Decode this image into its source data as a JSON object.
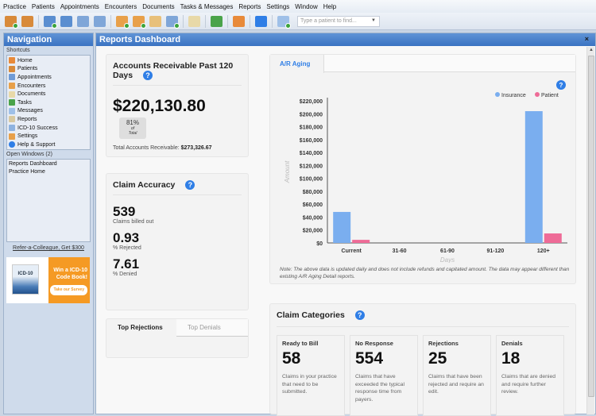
{
  "menu": [
    "Practice",
    "Patients",
    "Appointments",
    "Encounters",
    "Documents",
    "Tasks & Messages",
    "Reports",
    "Settings",
    "Window",
    "Help"
  ],
  "toolbar": {
    "icons": [
      {
        "name": "add-patient-icon",
        "color": "#d88a3a",
        "badge": true
      },
      {
        "name": "find-patient-icon",
        "color": "#d88a3a",
        "badge": false
      },
      {
        "name": "add-appointment-icon",
        "color": "#5a8ed0",
        "badge": true
      },
      {
        "name": "appointment-list-icon",
        "color": "#5a8ed0",
        "badge": false
      },
      {
        "name": "calendar-day-icon",
        "color": "#7fa6d8",
        "badge": false
      },
      {
        "name": "calendar-week-icon",
        "color": "#7fa6d8",
        "badge": false
      },
      {
        "name": "add-encounter-icon",
        "color": "#e8a04a",
        "badge": true
      },
      {
        "name": "approve-encounter-icon",
        "color": "#e8a04a",
        "badge": true
      },
      {
        "name": "documents-icon",
        "color": "#e8c07a",
        "badge": false
      },
      {
        "name": "add-message-icon",
        "color": "#7fa6d8",
        "badge": true
      },
      {
        "name": "reports-icon",
        "color": "#e8d9a8",
        "badge": false
      },
      {
        "name": "tasks-check-icon",
        "color": "#4aa34a",
        "badge": false
      },
      {
        "name": "home-icon",
        "color": "#e88a3a",
        "badge": false
      },
      {
        "name": "help-icon",
        "color": "#2f7ee6",
        "badge": false
      },
      {
        "name": "new-message-icon",
        "color": "#9fc0e8",
        "badge": true
      }
    ],
    "patient_search_placeholder": "Type a patient to find..."
  },
  "sidebar": {
    "title": "Navigation",
    "shortcuts_label": "Shortcuts",
    "shortcuts": [
      {
        "label": "Home",
        "icon": "home-icon",
        "color": "#e88a3a"
      },
      {
        "label": "Patients",
        "icon": "patients-icon",
        "color": "#d88a3a"
      },
      {
        "label": "Appointments",
        "icon": "appointments-icon",
        "color": "#6f9bd6"
      },
      {
        "label": "Encounters",
        "icon": "encounters-icon",
        "color": "#e8a04a"
      },
      {
        "label": "Documents",
        "icon": "documents-icon",
        "color": "#e8d9a8"
      },
      {
        "label": "Tasks",
        "icon": "check-icon",
        "color": "#4aa34a"
      },
      {
        "label": "Messages",
        "icon": "messages-icon",
        "color": "#9fc0e8"
      },
      {
        "label": "Reports",
        "icon": "reports-icon",
        "color": "#d9c9a0"
      },
      {
        "label": "ICD-10 Success",
        "icon": "icd10-icon",
        "color": "#8fb3e0"
      },
      {
        "label": "Settings",
        "icon": "settings-icon",
        "color": "#e8a04a"
      },
      {
        "label": "Help & Support",
        "icon": "help-icon",
        "color": "#2f7ee6"
      }
    ],
    "open_windows_label": "Open Windows (2)",
    "open_windows": [
      "Reports Dashboard",
      "Practice Home"
    ],
    "refer_link": "Refer-a-Colleague, Get $300",
    "ad": {
      "book_label": "ICD-10",
      "headline_1": "Win a ICD-10",
      "headline_2": "Code Book!",
      "button": "Take our Survey"
    }
  },
  "main": {
    "title": "Reports Dashboard",
    "close_glyph": "×",
    "ar_card": {
      "title": "Accounts Receivable Past 120 Days",
      "amount": "$220,130.80",
      "percent": "81%",
      "percent_sub_1": "of",
      "percent_sub_2": "Total",
      "total_label": "Total Accounts Receivable:",
      "total_value": "$273,326.67"
    },
    "claim_accuracy": {
      "title": "Claim Accuracy",
      "stats": [
        {
          "value": "539",
          "label": "Claims billed out"
        },
        {
          "value": "0.93",
          "label": "% Rejected"
        },
        {
          "value": "7.61",
          "label": "% Denied"
        }
      ]
    },
    "top_tabs": {
      "active": "Top Rejections",
      "inactive": "Top Denials"
    },
    "aging": {
      "tab": "A/R Aging",
      "note": "Note: The above data is updated daily and does not include refunds and capitated amount. The data may appear different than existing A/R Aging Detail reports."
    },
    "claim_categories": {
      "title": "Claim Categories",
      "items": [
        {
          "title": "Ready to Bill",
          "value": "58",
          "desc": "Claims in your practice that need to be submitted."
        },
        {
          "title": "No Response",
          "value": "554",
          "desc": "Claims that have exceeded the typical response time from payers."
        },
        {
          "title": "Rejections",
          "value": "25",
          "desc": "Claims that have been rejected and require an edit."
        },
        {
          "title": "Denials",
          "value": "18",
          "desc": "Claims that are denied and require further review."
        }
      ]
    }
  },
  "chart_data": {
    "type": "bar",
    "title": "A/R Aging",
    "categories": [
      "Current",
      "31-60",
      "61-90",
      "91-120",
      "120+"
    ],
    "series": [
      {
        "name": "Insurance",
        "color": "#7aaeef",
        "values": [
          48000,
          0,
          0,
          0,
          204000
        ]
      },
      {
        "name": "Patient",
        "color": "#ee6b97",
        "values": [
          4800,
          0,
          0,
          0,
          14700
        ]
      }
    ],
    "xlabel": "Days",
    "ylabel": "Amount",
    "ylim": [
      0,
      220000
    ],
    "yticks": [
      0,
      20000,
      40000,
      60000,
      80000,
      100000,
      120000,
      140000,
      160000,
      180000,
      200000,
      220000
    ],
    "ytick_labels": [
      "$0",
      "$20,000",
      "$40,000",
      "$60,000",
      "$80,000",
      "$100,000",
      "$120,000",
      "$140,000",
      "$160,000",
      "$180,000",
      "$200,000",
      "$220,000"
    ],
    "legend": "top-right",
    "grid": false
  }
}
